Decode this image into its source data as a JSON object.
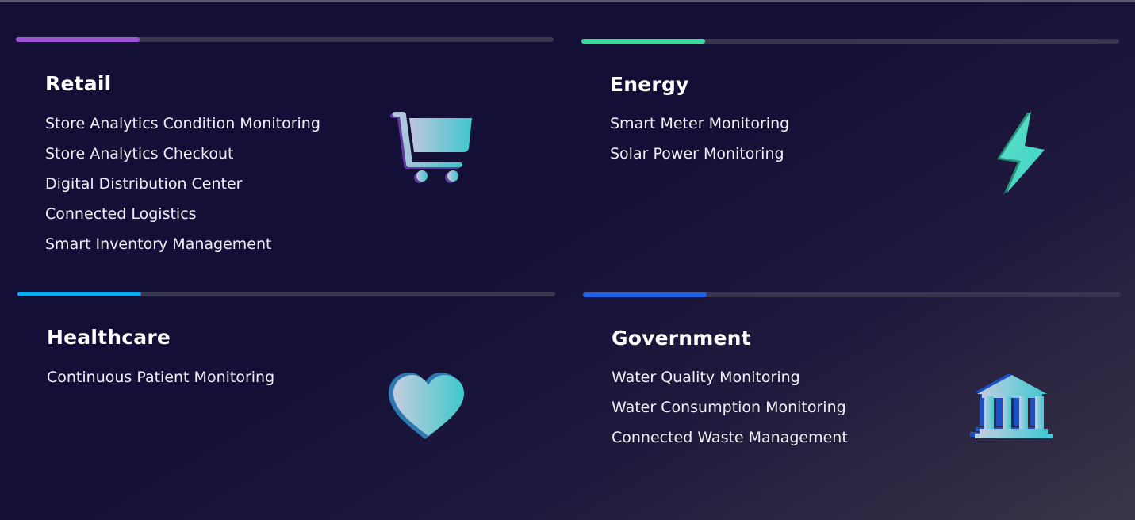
{
  "colors": {
    "track": "#3a3650",
    "retail_accent": "#9b55d4",
    "energy_accent": "#3fd6a0",
    "healthcare_accent": "#13a6f0",
    "government_accent": "#1f64e8",
    "icon_gradient_start": "#b8c4dc",
    "icon_gradient_end": "#3fc8cc"
  },
  "cards": [
    {
      "id": "retail",
      "title": "Retail",
      "icon": "shopping-cart-icon",
      "progress": 0.23,
      "items": [
        "Store Analytics Condition Monitoring",
        "Store Analytics Checkout",
        "Digital Distribution Center",
        "Connected Logistics",
        "Smart Inventory Management"
      ]
    },
    {
      "id": "energy",
      "title": "Energy",
      "icon": "lightning-bolt-icon",
      "progress": 0.23,
      "items": [
        "Smart Meter Monitoring",
        "Solar Power Monitoring"
      ]
    },
    {
      "id": "healthcare",
      "title": "Healthcare",
      "icon": "heart-icon",
      "progress": 0.23,
      "items": [
        "Continuous Patient Monitoring"
      ]
    },
    {
      "id": "government",
      "title": "Government",
      "icon": "government-building-icon",
      "progress": 0.23,
      "items": [
        "Water Quality Monitoring",
        "Water Consumption Monitoring",
        "Connected Waste Management"
      ]
    }
  ]
}
